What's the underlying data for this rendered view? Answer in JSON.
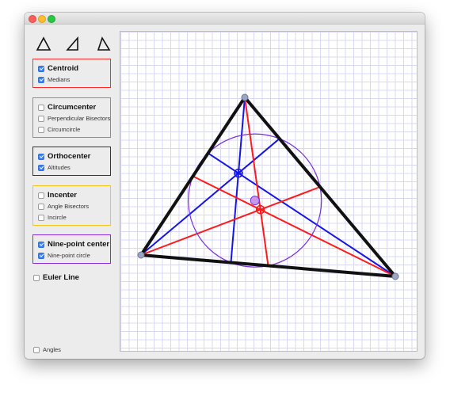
{
  "toolbar": {
    "triangle_buttons": [
      {
        "icon": "equilateral-triangle-icon"
      },
      {
        "icon": "right-triangle-icon"
      },
      {
        "icon": "isosceles-triangle-icon"
      }
    ]
  },
  "panels": [
    {
      "id": "centroid",
      "color": "#ff2a2a",
      "label": "Centroid",
      "checked": true,
      "options": [
        {
          "label": "Medians",
          "checked": true
        }
      ]
    },
    {
      "id": "circumcenter",
      "color": "#33cc33",
      "label": "Circumcenter",
      "checked": false,
      "options": [
        {
          "label": "Perpendicular Bisectors",
          "checked": false
        },
        {
          "label": "Circumcircle",
          "checked": false
        }
      ]
    },
    {
      "id": "orthocenter",
      "color": "#1f1fd6",
      "label": "Orthocenter",
      "checked": true,
      "options": [
        {
          "label": "Altitudes",
          "checked": true
        }
      ]
    },
    {
      "id": "incenter",
      "color": "#f5c518",
      "label": "Incenter",
      "checked": false,
      "options": [
        {
          "label": "Angle Bisectors",
          "checked": false
        },
        {
          "label": "Incircle",
          "checked": false
        }
      ]
    },
    {
      "id": "nine-point",
      "color": "#8a2be2",
      "label": "Nine-point center",
      "checked": true,
      "options": [
        {
          "label": "Nine-point circle",
          "checked": true
        }
      ]
    }
  ],
  "euler": {
    "label": "Euler Line",
    "checked": false
  },
  "angles": {
    "label": "Angles",
    "checked": false
  },
  "colors": {
    "triangle": "#111111",
    "medians": "#ff1a1a",
    "altitudes": "#1515e6",
    "nine_point_circle": "#7b2ee0",
    "vertex_handle": "#9aa6c4"
  }
}
